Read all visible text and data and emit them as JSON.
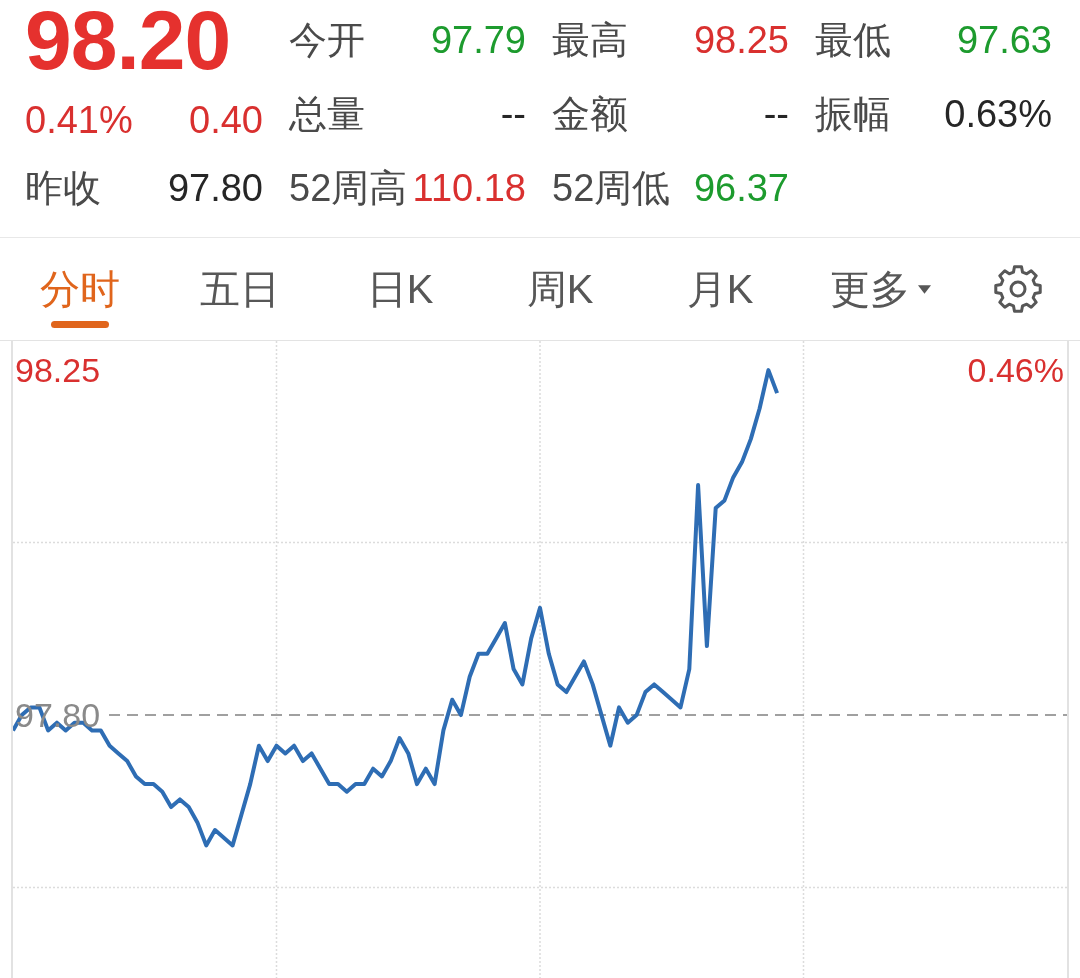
{
  "quote": {
    "rows": [
      [
        {
          "kind": "price",
          "text": "98.20",
          "color": "#e5312e"
        },
        {
          "kind": "stat",
          "label": "今开",
          "value": "97.79",
          "color": "#1d9b2e"
        },
        {
          "kind": "stat",
          "label": "最高",
          "value": "98.25",
          "color": "#d9302f"
        },
        {
          "kind": "stat",
          "label": "最低",
          "value": "97.63",
          "color": "#1d9b2e"
        }
      ],
      [
        {
          "kind": "change",
          "percent": "0.41%",
          "amount": "0.40",
          "color": "#d9302f"
        },
        {
          "kind": "stat",
          "label": "总量",
          "value": "--",
          "color": "#262626"
        },
        {
          "kind": "stat",
          "label": "金额",
          "value": "--",
          "color": "#262626"
        },
        {
          "kind": "stat",
          "label": "振幅",
          "value": "0.63%",
          "color": "#262626"
        }
      ],
      [
        {
          "kind": "stat",
          "label": "昨收",
          "value": "97.80",
          "color": "#262626"
        },
        {
          "kind": "stat",
          "label": "52周高",
          "value": "110.18",
          "color": "#d9302f"
        },
        {
          "kind": "stat",
          "label": "52周低",
          "value": "96.37",
          "color": "#1d9b2e"
        }
      ]
    ]
  },
  "tabs": [
    {
      "label": "分时",
      "selected": true,
      "dropdown": false
    },
    {
      "label": "五日",
      "selected": false,
      "dropdown": false
    },
    {
      "label": "日K",
      "selected": false,
      "dropdown": false
    },
    {
      "label": "周K",
      "selected": false,
      "dropdown": false
    },
    {
      "label": "月K",
      "selected": false,
      "dropdown": false
    },
    {
      "label": "更多",
      "selected": false,
      "dropdown": true
    }
  ],
  "chart": {
    "right_axis_label": {
      "text": "0.46%",
      "color": "#d9302f"
    },
    "chart_data": {
      "type": "line",
      "categories": [
        null,
        null,
        null,
        null,
        null,
        null,
        null,
        null,
        null,
        null,
        null,
        null,
        null,
        null,
        null,
        null,
        null,
        null,
        null,
        null,
        null,
        null,
        null,
        null,
        null,
        null,
        null,
        null,
        null,
        null,
        null,
        null,
        null,
        null,
        null,
        null,
        null,
        null,
        null,
        null,
        null,
        null,
        null,
        null,
        null,
        null,
        null,
        null,
        null,
        null,
        null,
        null,
        null,
        null,
        null,
        null,
        null,
        null,
        null,
        null,
        null,
        null,
        null,
        null,
        null,
        null,
        null,
        null,
        null,
        null,
        null,
        null,
        null,
        null,
        null,
        null,
        null,
        null,
        null,
        null,
        null,
        null,
        null,
        null,
        null,
        null,
        null,
        null,
        null,
        null,
        null,
        null,
        null,
        null,
        null,
        null,
        null,
        null,
        null,
        null,
        null,
        null,
        null,
        null,
        null,
        null,
        null,
        null,
        null,
        null,
        null,
        null,
        null,
        null,
        null,
        null,
        null,
        null,
        null,
        null,
        null
      ],
      "series": [
        {
          "color": "#2e6db4",
          "values": [
            97.78,
            97.8,
            97.81,
            97.81,
            97.78,
            97.79,
            97.78,
            97.79,
            97.79,
            97.78,
            97.78,
            97.76,
            97.75,
            97.74,
            97.72,
            97.71,
            97.71,
            97.7,
            97.68,
            97.69,
            97.68,
            97.66,
            97.63,
            97.65,
            97.64,
            97.63,
            97.67,
            97.71,
            97.76,
            97.74,
            97.76,
            97.75,
            97.76,
            97.74,
            97.75,
            97.73,
            97.71,
            97.71,
            97.7,
            97.71,
            97.71,
            97.73,
            97.72,
            97.74,
            97.77,
            97.75,
            97.71,
            97.73,
            97.71,
            97.78,
            97.82,
            97.8,
            97.85,
            97.88,
            97.88,
            97.9,
            97.92,
            97.86,
            97.84,
            97.9,
            97.94,
            97.88,
            97.84,
            97.83,
            97.85,
            97.87,
            97.84,
            97.8,
            97.76,
            97.81,
            97.79,
            97.8,
            97.83,
            97.84,
            97.83,
            97.82,
            97.81,
            97.86,
            98.1,
            97.89,
            98.07,
            98.08,
            98.11,
            98.13,
            98.16,
            98.2,
            98.25,
            98.22,
            null,
            null,
            null,
            null,
            null,
            null,
            null,
            null,
            null,
            null,
            null,
            null,
            null,
            null,
            null,
            null,
            null,
            null,
            null,
            null,
            null,
            null,
            null,
            null,
            null,
            null,
            null,
            null,
            null,
            null,
            null,
            null,
            null
          ]
        }
      ],
      "ylim": [
        97.457,
        98.288
      ],
      "yticks": [
        {
          "value": 98.25,
          "label": "98.25"
        },
        {
          "value": 97.8,
          "label": "97.80"
        }
      ],
      "grid": true,
      "ref_lines": [
        {
          "axis": "y",
          "value": 97.8,
          "color": "#a0a0a0"
        }
      ]
    }
  }
}
